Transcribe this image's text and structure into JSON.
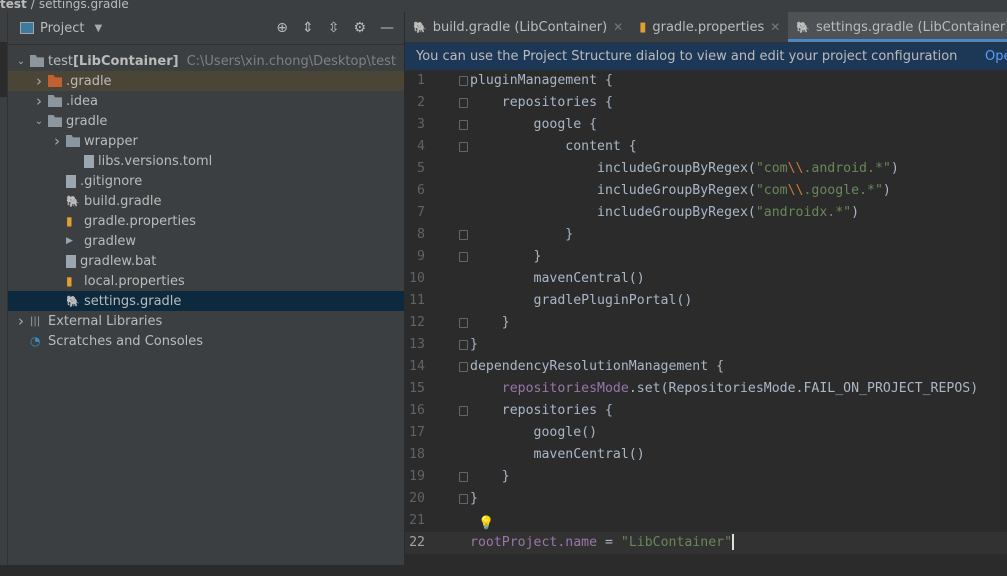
{
  "breadcrumb": [
    "test",
    "settings.gradle"
  ],
  "project_panel": {
    "title": "Project",
    "tree": [
      {
        "label": "test",
        "extra": "[LibContainer]",
        "path": "C:\\Users\\xin.chong\\Desktop\\test",
        "depth": 0,
        "arrow": "down",
        "icon": "module"
      },
      {
        "label": ".gradle",
        "depth": 1,
        "arrow": "right",
        "icon": "folder-orange"
      },
      {
        "label": ".idea",
        "depth": 1,
        "arrow": "right",
        "icon": "folder"
      },
      {
        "label": "gradle",
        "depth": 1,
        "arrow": "down",
        "icon": "folder"
      },
      {
        "label": "wrapper",
        "depth": 2,
        "arrow": "right",
        "icon": "folder"
      },
      {
        "label": "libs.versions.toml",
        "depth": 3,
        "icon": "toml"
      },
      {
        "label": ".gitignore",
        "depth": 2,
        "icon": "file"
      },
      {
        "label": "build.gradle",
        "depth": 2,
        "icon": "gradle"
      },
      {
        "label": "gradle.properties",
        "depth": 2,
        "icon": "properties"
      },
      {
        "label": "gradlew",
        "depth": 2,
        "icon": "script"
      },
      {
        "label": "gradlew.bat",
        "depth": 2,
        "icon": "file"
      },
      {
        "label": "local.properties",
        "depth": 2,
        "icon": "properties"
      },
      {
        "label": "settings.gradle",
        "depth": 2,
        "icon": "gradle",
        "selected": true
      },
      {
        "label": "External Libraries",
        "depth": 0,
        "arrow": "right",
        "icon": "library"
      },
      {
        "label": "Scratches and Consoles",
        "depth": 0,
        "icon": "scratch"
      }
    ]
  },
  "tabs": [
    {
      "label": "build.gradle (LibContainer)"
    },
    {
      "label": "gradle.properties"
    },
    {
      "label": "settings.gradle (LibContainer)",
      "active": true
    }
  ],
  "banner": {
    "text": "You can use the Project Structure dialog to view and edit your project configuration",
    "link": "Ope"
  },
  "code_lines": [
    "pluginManagement {",
    "    repositories {",
    "        google {",
    "            content {",
    "                includeGroupByRegex(\"com\\\\.android.*\")",
    "                includeGroupByRegex(\"com\\\\.google.*\")",
    "                includeGroupByRegex(\"androidx.*\")",
    "            }",
    "        }",
    "        mavenCentral()",
    "        gradlePluginPortal()",
    "    }",
    "}",
    "dependencyResolutionManagement {",
    "    repositoriesMode.set(RepositoriesMode.FAIL_ON_PROJECT_REPOS)",
    "    repositories {",
    "        google()",
    "        mavenCentral()",
    "    }",
    "}",
    "",
    "rootProject.name = \"LibContainer\"",
    ""
  ],
  "current_line": 22
}
